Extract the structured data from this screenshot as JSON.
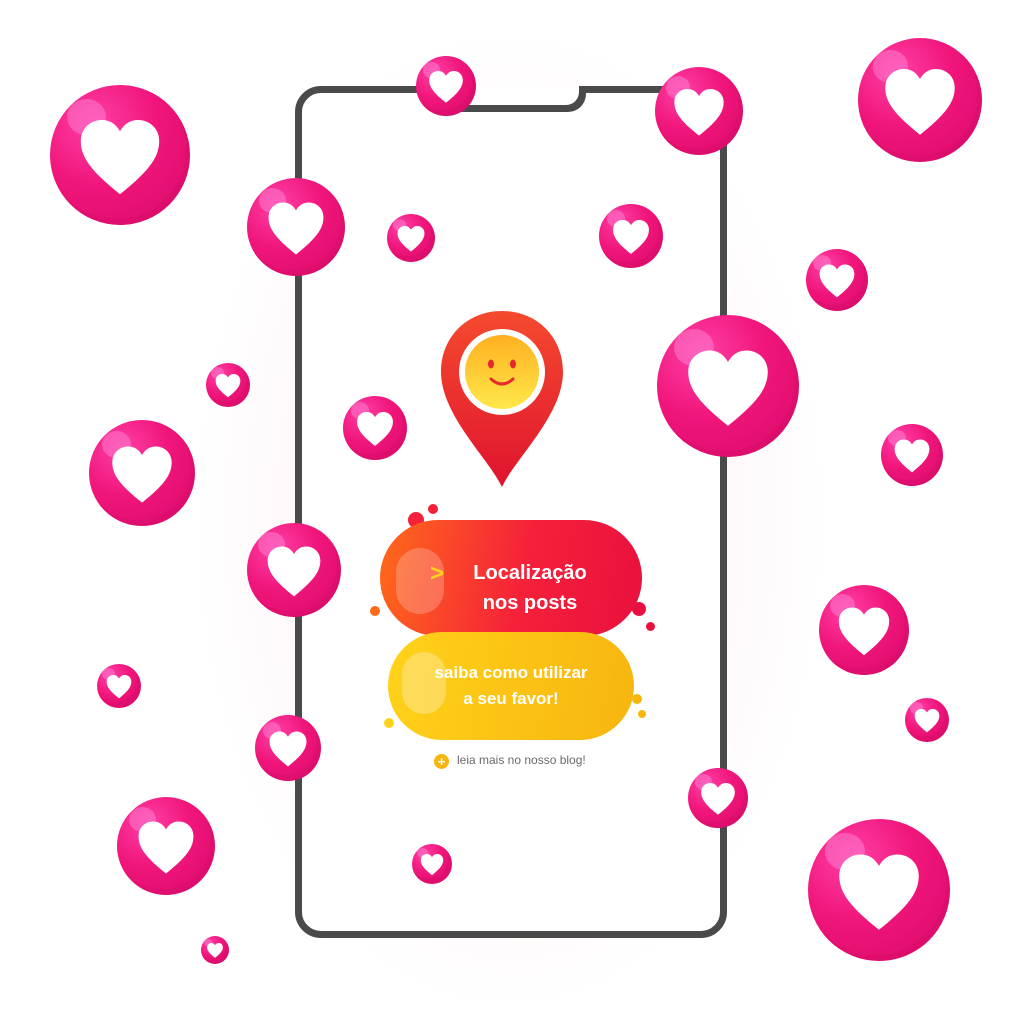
{
  "button_primary": {
    "arrow": ">",
    "line1": "Localização",
    "line2": "nos posts"
  },
  "button_secondary": {
    "line1": "saiba como utilizar",
    "line2": "a seu favor!"
  },
  "blog_link": {
    "icon": "plus-icon",
    "label": "leia mais no nosso blog!"
  },
  "icons": {
    "pin": "location-pin-icon",
    "face": "smiley-face-icon",
    "bubble": "heart-icon"
  },
  "colors": {
    "heart_bubble": "#f0157a",
    "primary_button": "#f5203a",
    "secondary_button": "#f7b50f",
    "phone_frame": "#4a4a4a",
    "face": "#ffcf1a"
  }
}
